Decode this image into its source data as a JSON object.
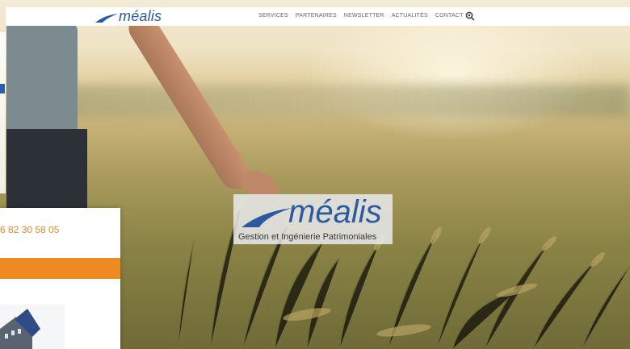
{
  "header": {
    "brand": "méalis",
    "nav": [
      "SERVICES",
      "PARTENAIRES",
      "NEWSLETTER",
      "ACTUALITÉS",
      "CONTACT"
    ],
    "search_icon": "search-icon"
  },
  "hero": {
    "logo_text": "méalis",
    "tagline": "Gestion et Ingénierie Patrimoniales"
  },
  "left_panel": {
    "phone": "6 82 30 58 05"
  },
  "colors": {
    "brand_blue": "#2b5aa3",
    "accent_orange": "#ef8a22",
    "nav_text": "#666666"
  }
}
